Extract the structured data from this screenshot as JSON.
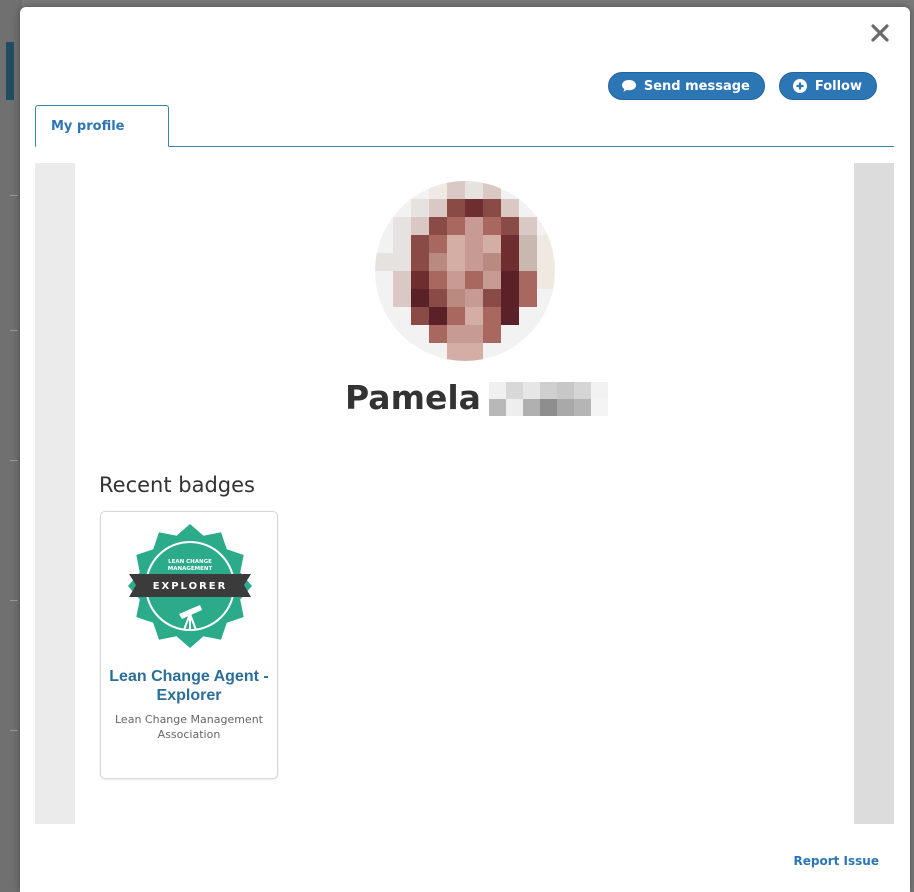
{
  "modal": {
    "close_icon": "close-icon"
  },
  "actions": {
    "send_message_label": "Send message",
    "send_message_icon": "chat-bubble-icon",
    "follow_label": "Follow",
    "follow_icon": "plus-circle-icon"
  },
  "tabs": [
    {
      "label": "My profile",
      "active": true
    }
  ],
  "profile": {
    "first_name": "Pamela",
    "last_name_obscured": true,
    "avatar_obscured": true
  },
  "badges_section": {
    "title": "Recent badges",
    "items": [
      {
        "name": "Lean Change Agent - Explorer",
        "issuer": "Lean Change Management Association",
        "image": {
          "top_text": "LEAN CHANGE MANAGEMENT",
          "ribbon_text": "EXPLORER",
          "icon": "telescope-icon"
        }
      }
    ]
  },
  "footer": {
    "report_label": "Report Issue"
  },
  "colors": {
    "accent": "#2d76b6",
    "badge_green": "#2bab8a",
    "badge_ribbon": "#3b3b3b"
  }
}
